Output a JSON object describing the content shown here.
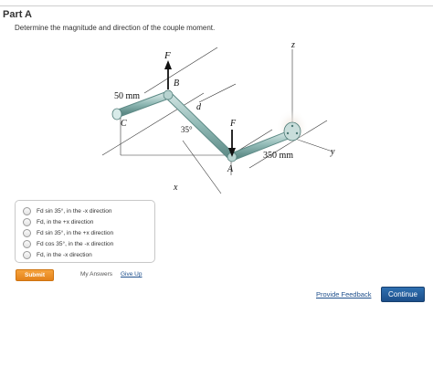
{
  "part": {
    "title": "Part A"
  },
  "question": {
    "text": "Determine the magnitude and direction of the couple moment."
  },
  "figure": {
    "labels": {
      "F_top": "F",
      "B": "B",
      "dim_50": "50 mm",
      "d": "d",
      "C": "C",
      "angle": "35°",
      "F_mid": "F",
      "dim_350": "350 mm",
      "A": "A",
      "x": "x",
      "y": "y",
      "z": "z"
    },
    "colors": {
      "pipe": "#8fb8b4",
      "pipe_dark": "#5d8a86",
      "wall": "#d9c9b8"
    }
  },
  "options": [
    {
      "label": "Fd sin 35°, in the -x direction"
    },
    {
      "label": "Fd, in the +x direction"
    },
    {
      "label": "Fd sin 35°, in the +x direction"
    },
    {
      "label": "Fd cos 35°, in the -x direction"
    },
    {
      "label": "Fd, in the -x direction"
    }
  ],
  "actions": {
    "submit": "Submit",
    "my_answers": "My Answers",
    "give_up": "Give Up",
    "feedback": "Provide Feedback",
    "continue": "Continue"
  }
}
